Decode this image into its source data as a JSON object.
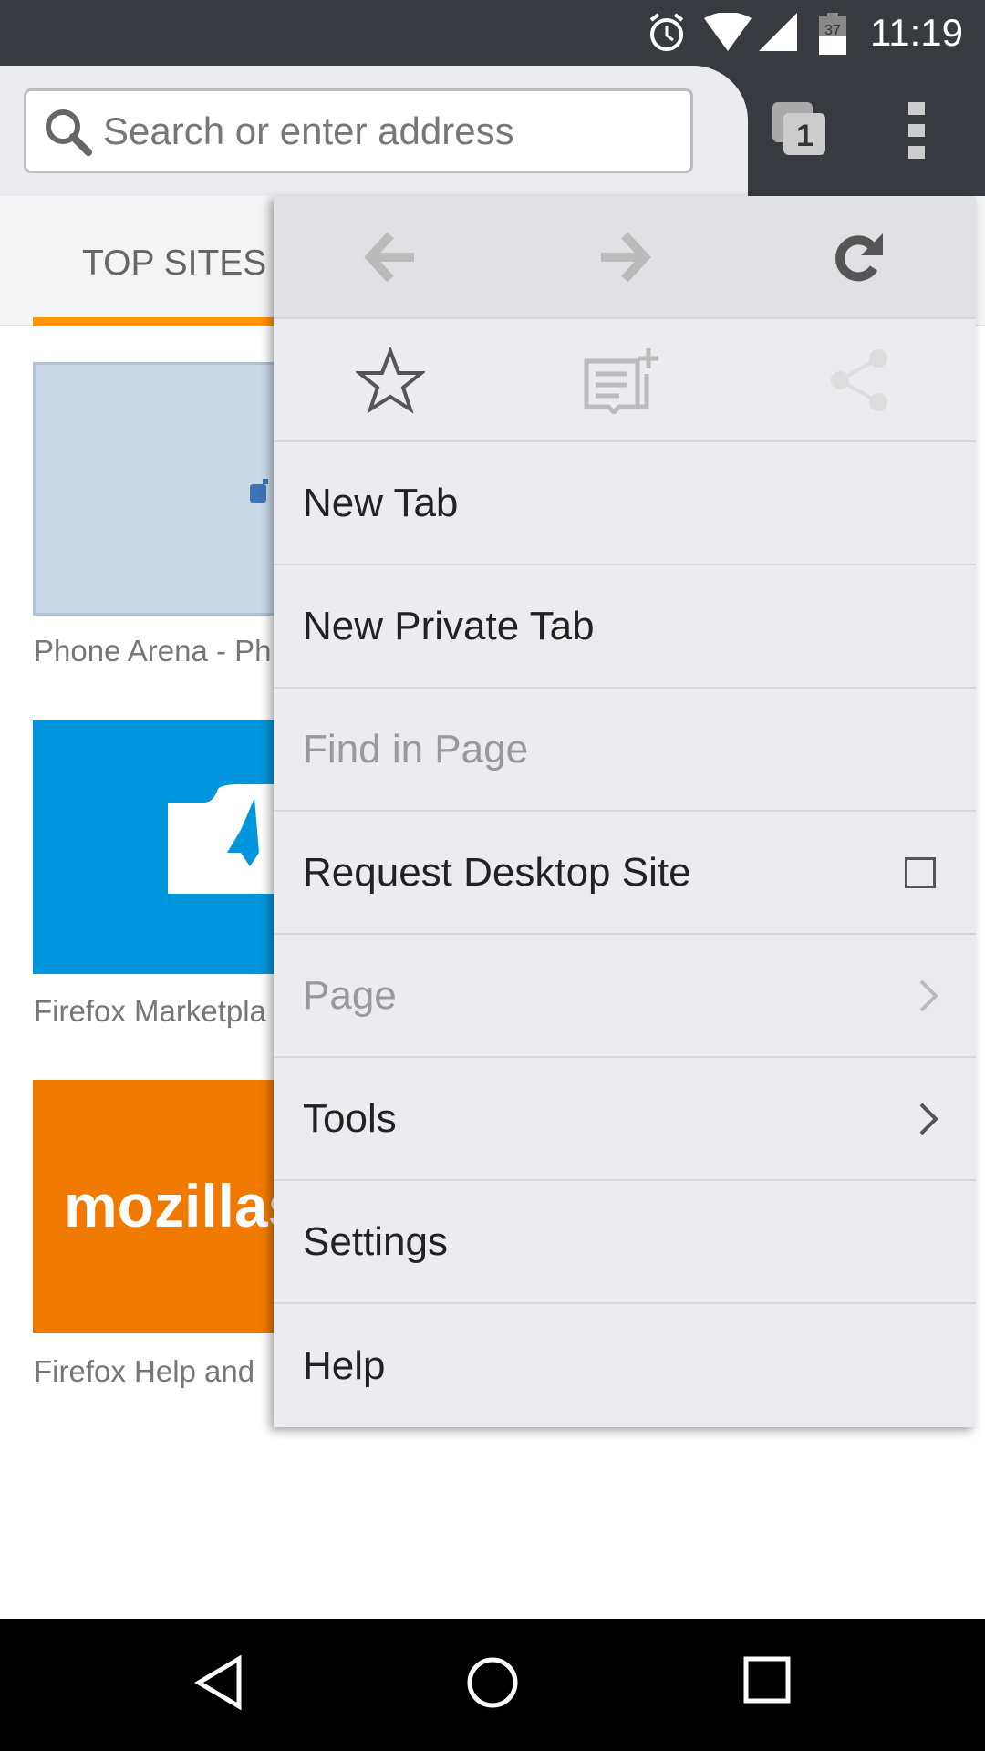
{
  "status_bar": {
    "time": "11:19",
    "battery": "37",
    "icons": [
      "alarm-icon",
      "wifi-icon",
      "signal-icon",
      "battery-icon"
    ]
  },
  "toolbar": {
    "search_placeholder": "Search or enter address",
    "tab_count": "1"
  },
  "tabs": {
    "active": "TOP SITES"
  },
  "top_sites": [
    {
      "label": "Phone Arena - Ph",
      "color": "#cad9e8"
    },
    {
      "label": "Firefox Marketpla",
      "color": "#0096dd"
    },
    {
      "label": "Firefox Help and",
      "color": "#f07a00",
      "logo_text": "mozillas"
    }
  ],
  "menu": {
    "nav_icons": [
      "back-icon",
      "forward-icon",
      "reload-icon"
    ],
    "action_icons": [
      "bookmark-star-icon",
      "reading-list-add-icon",
      "share-icon"
    ],
    "items": [
      {
        "label": "New Tab",
        "enabled": true
      },
      {
        "label": "New Private Tab",
        "enabled": true
      },
      {
        "label": "Find in Page",
        "enabled": false
      },
      {
        "label": "Request Desktop Site",
        "enabled": true,
        "checkbox": false
      },
      {
        "label": "Page",
        "enabled": false,
        "submenu": true
      },
      {
        "label": "Tools",
        "enabled": true,
        "submenu": true
      },
      {
        "label": "Settings",
        "enabled": true
      },
      {
        "label": "Help",
        "enabled": true
      }
    ]
  },
  "accent": "#ff9500"
}
